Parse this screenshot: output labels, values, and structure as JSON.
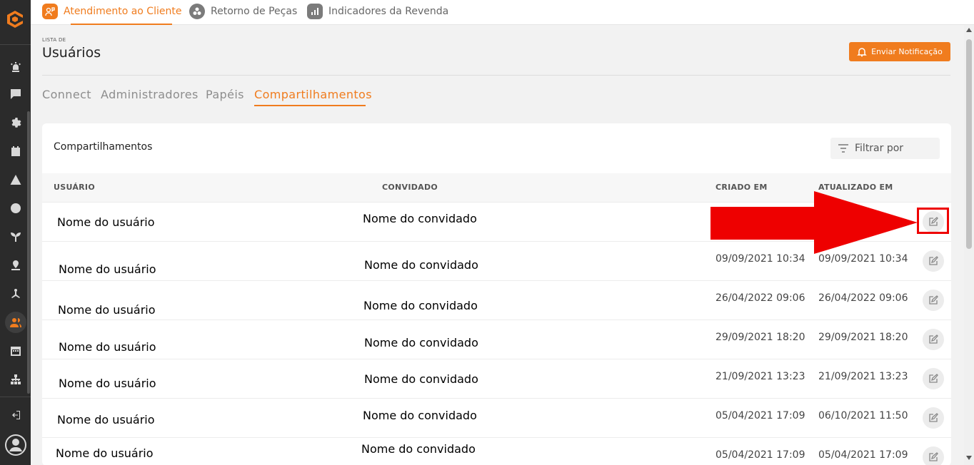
{
  "top_nav": {
    "items": [
      {
        "label": "Atendimento ao Cliente",
        "active": true
      },
      {
        "label": "Retorno de Peças",
        "active": false
      },
      {
        "label": "Indicadores da Revenda",
        "active": false
      }
    ]
  },
  "header": {
    "overline": "LISTA DE",
    "title": "Usuários",
    "notify_label": "Enviar Notificação"
  },
  "tabs": [
    {
      "label": "Connect"
    },
    {
      "label": "Administradores"
    },
    {
      "label": "Papéis"
    },
    {
      "label": "Compartilhamentos"
    }
  ],
  "card": {
    "title": "Compartilhamentos",
    "filter_placeholder": "Filtrar por",
    "columns": {
      "user": "USUÁRIO",
      "guest": "CONVIDADO",
      "created": "CRIADO EM",
      "updated": "ATUALIZADO EM"
    },
    "rows": [
      {
        "user": "Nome do usuário",
        "guest": "Nome do convidado",
        "created": "",
        "updated": ""
      },
      {
        "user": "Nome do usuário",
        "guest": "Nome do convidado",
        "created": "09/09/2021 10:34",
        "updated": "09/09/2021 10:34"
      },
      {
        "user": "Nome do usuário",
        "guest": "Nome do convidado",
        "created": "26/04/2022 09:06",
        "updated": "26/04/2022 09:06"
      },
      {
        "user": "Nome do usuário",
        "guest": "Nome do convidado",
        "created": "29/09/2021 18:20",
        "updated": "29/09/2021 18:20"
      },
      {
        "user": "Nome do usuário",
        "guest": "Nome do convidado",
        "created": "21/09/2021 13:23",
        "updated": "21/09/2021 13:23"
      },
      {
        "user": "Nome do usuário",
        "guest": "Nome do convidado",
        "created": "05/04/2021 17:09",
        "updated": "06/10/2021 11:50"
      },
      {
        "user": "Nome do usuário",
        "guest": "Nome do convidado",
        "created": "05/04/2021 17:09",
        "updated": "05/04/2021 17:09"
      }
    ]
  },
  "colors": {
    "accent": "#f07c1e",
    "sidebar": "#2b2b2b",
    "annotation": "#ee0000"
  },
  "icons": {
    "sidebar": [
      "logo-icon",
      "alarm-icon",
      "chat-icon",
      "settings-icon",
      "calendar-icon",
      "warning-icon",
      "globe-icon",
      "plant-icon",
      "location-icon",
      "network-icon",
      "users-icon",
      "schedule-icon",
      "hierarchy-icon",
      "logout-icon",
      "profile-icon"
    ]
  }
}
